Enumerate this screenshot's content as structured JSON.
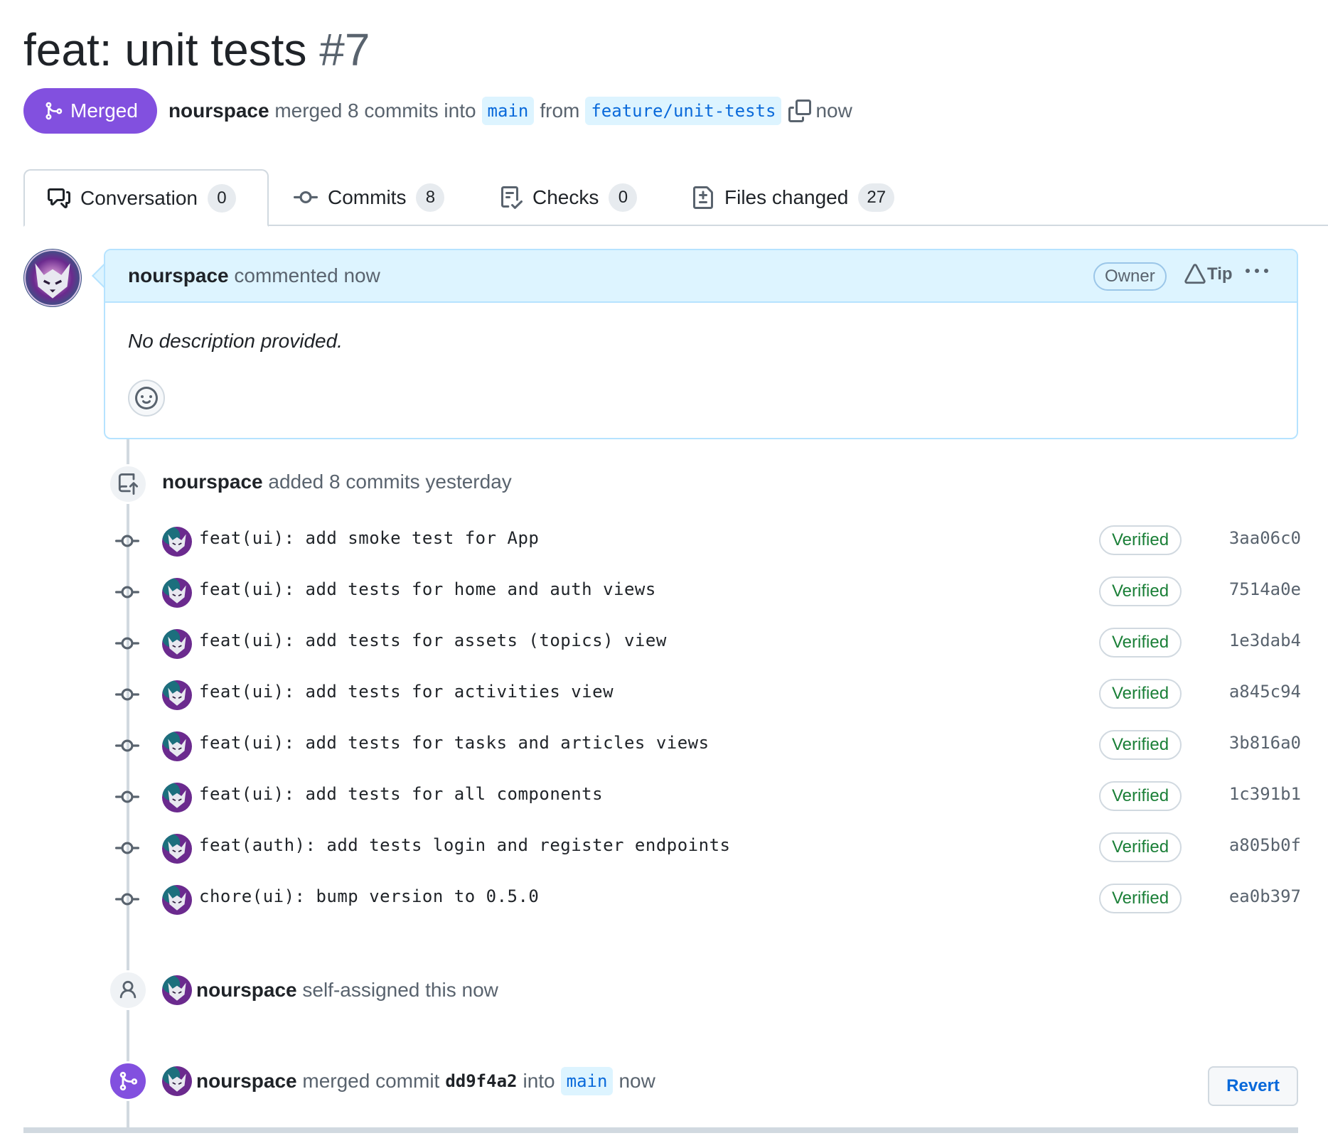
{
  "pr": {
    "title": "feat: unit tests",
    "number": "#7",
    "status_label": "Merged",
    "author": "nourspace",
    "merge_text": "merged 8 commits into",
    "base_branch": "main",
    "from_text": "from",
    "head_branch": "feature/unit-tests",
    "time": "now"
  },
  "tabs": [
    {
      "label": "Conversation",
      "count": "0",
      "icon": "comment-discussion-icon"
    },
    {
      "label": "Commits",
      "count": "8",
      "icon": "git-commit-icon"
    },
    {
      "label": "Checks",
      "count": "0",
      "icon": "checklist-icon"
    },
    {
      "label": "Files changed",
      "count": "27",
      "icon": "file-diff-icon"
    }
  ],
  "comment": {
    "author": "nourspace",
    "action": "commented now",
    "badge": "Owner",
    "tip_label": "Tip",
    "body": "No description provided."
  },
  "events": {
    "commits_added": {
      "author": "nourspace",
      "text": "added 8 commits yesterday"
    },
    "self_assigned": {
      "author": "nourspace",
      "text": "self-assigned this now"
    },
    "merged": {
      "author": "nourspace",
      "text_before": "merged commit",
      "commit": "dd9f4a2",
      "text_into": "into",
      "branch": "main",
      "time": "now",
      "revert_label": "Revert"
    }
  },
  "commits": [
    {
      "message": "feat(ui): add smoke test for App",
      "status": "Verified",
      "sha": "3aa06c0"
    },
    {
      "message": "feat(ui): add tests for home and auth views",
      "status": "Verified",
      "sha": "7514a0e"
    },
    {
      "message": "feat(ui): add tests for assets (topics) view",
      "status": "Verified",
      "sha": "1e3dab4"
    },
    {
      "message": "feat(ui): add tests for activities view",
      "status": "Verified",
      "sha": "a845c94"
    },
    {
      "message": "feat(ui): add tests for tasks and articles views",
      "status": "Verified",
      "sha": "3b816a0"
    },
    {
      "message": "feat(ui): add tests for all components",
      "status": "Verified",
      "sha": "1c391b1"
    },
    {
      "message": "feat(auth): add tests login and register endpoints",
      "status": "Verified",
      "sha": "a805b0f"
    },
    {
      "message": "chore(ui): bump version to 0.5.0",
      "status": "Verified",
      "sha": "ea0b397"
    }
  ],
  "colors": {
    "merged_purple": "#8250df",
    "verified_green": "#1a7f37",
    "link_blue": "#0969da",
    "comment_header_bg": "#ddf4ff"
  }
}
